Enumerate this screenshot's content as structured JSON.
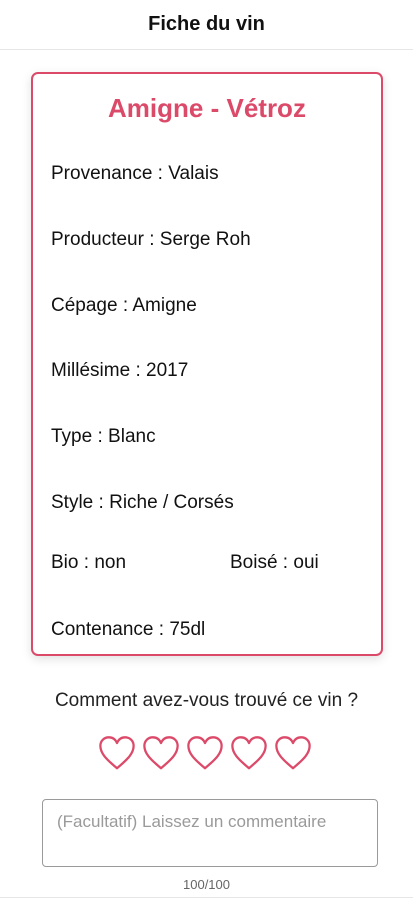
{
  "header": {
    "title": "Fiche du vin"
  },
  "wine": {
    "name": "Amigne - Vétroz",
    "fields": {
      "provenance": {
        "label": "Provenance",
        "value": "Valais"
      },
      "producteur": {
        "label": "Producteur",
        "value": "Serge Roh"
      },
      "cepage": {
        "label": "Cépage",
        "value": "Amigne"
      },
      "millesime": {
        "label": "Millésime",
        "value": "2017"
      },
      "type": {
        "label": "Type",
        "value": "Blanc"
      },
      "style": {
        "label": "Style",
        "value": "Riche / Corsés"
      },
      "bio": {
        "label": "Bio",
        "value": "non"
      },
      "boise": {
        "label": "Boisé",
        "value": "oui"
      },
      "contenance": {
        "label": "Contenance",
        "value": "75dl"
      }
    }
  },
  "rating": {
    "question": "Comment avez-vous trouvé ce vin ?",
    "max": 5,
    "value": 0,
    "icon": "heart-outline-icon"
  },
  "comment": {
    "placeholder": "(Facultatif) Laissez un commentaire",
    "value": "",
    "counter": "100/100"
  },
  "colors": {
    "accent": "#dc4a6a"
  }
}
